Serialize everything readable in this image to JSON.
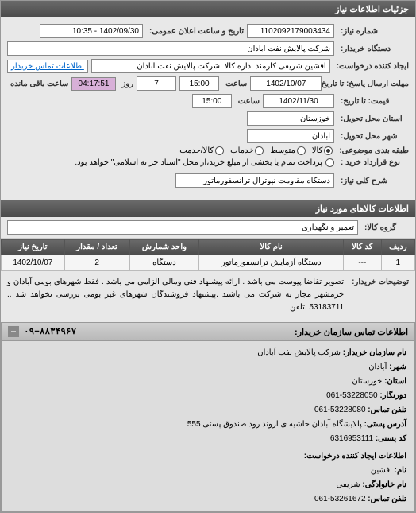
{
  "header": {
    "title": "جزئیات اطلاعات نیاز"
  },
  "form": {
    "request_no_label": "شماره نیاز:",
    "request_no": "1102092179003434",
    "announce_label": "تاریخ و ساعت اعلان عمومی:",
    "announce_value": "1402/09/30 - 10:35",
    "buyer_org_label": "دستگاه خریدار:",
    "buyer_org": "شرکت پالایش نفت آبادان",
    "creator_label": "ایجاد کننده درخواست:",
    "creator": "افشین شریفی کارمند اداره کالا  شرکت پالایش نفت آبادان",
    "contact_link": "اطلاعات تماس خریدار",
    "deadline_label": "مهلت ارسال پاسخ: تا تاریخ:",
    "deadline_date": "1402/10/07",
    "deadline_hour_label": "ساعت",
    "deadline_hour": "15:00",
    "day": "7",
    "day_label": "روز",
    "countdown": "04:17:51",
    "remain_label": "ساعت باقی مانده",
    "price_until_label": "قیمت: تا تاریخ:",
    "price_date": "1402/11/30",
    "price_hour": "15:00",
    "delivery_state_label": "استان محل تحویل:",
    "delivery_state": "خوزستان",
    "delivery_city_label": "شهر محل تحویل:",
    "delivery_city": "آبادان",
    "classification_label": "طبقه بندی موضوعی:",
    "radio_kala": "کالا",
    "radio_khadmat": "خدمات",
    "radio_kala_khadmat": "کالا/خدمت",
    "radio_avg": "متوسط",
    "contract_type_label": "نوع قرارداد خرید :",
    "contract_note": "پرداخت تمام یا بخشی از مبلغ خرید،از محل \"اسناد خزانه اسلامی\" خواهد بود.",
    "need_desc_label": "شرح کلی نیاز:",
    "need_desc": "دستگاه مقاومت نیوترال ترانسفورماتور"
  },
  "goods_section_title": "اطلاعات کالاهای مورد نیاز",
  "goods_group_label": "گروه کالا:",
  "goods_group": "تعمیر و نگهداری",
  "table": {
    "cols": [
      "ردیف",
      "کد کالا",
      "نام کالا",
      "واحد شمارش",
      "تعداد / مقدار",
      "تاریخ نیاز"
    ],
    "rows": [
      {
        "c0": "1",
        "c1": "---",
        "c2": "دستگاه آزمایش ترانسفورماتور",
        "c3": "دستگاه",
        "c4": "2",
        "c5": "1402/10/07"
      }
    ]
  },
  "buyer_notes_label": "توضیحات خریدار:",
  "buyer_notes": "تصویر تقاضا پیوست می باشد . ارائه پیشنهاد فنی ومالی الزامی می باشد . فقط شهرهای بومی آبادان و خرمشهر مجاز به شرکت می باشند .پیشنهاد فروشندگان شهرهای غیر بومی بررسی نخواهد شد .. 53183711 .تلفن",
  "contact": {
    "panel_title": "اطلاعات تماس سازمان خریدار:",
    "barcode": "۰۹−۸۸۳۴۹۶۷",
    "org_label": "نام سازمان خریدار:",
    "org": "شرکت پالایش نفت آبادان",
    "city_label": "شهر:",
    "city": "آبادان",
    "province_label": "استان:",
    "province": "خوزستان",
    "fax_label": "دورنگار:",
    "fax": "53228050-061",
    "phone_label": "تلفن تماس:",
    "phone": "53228080-061",
    "address_label": "آدرس پستی:",
    "address": "پالایشگاه آبادان حاشیه ی اروند رود صندوق پستی 555",
    "postal_label": "کد پستی:",
    "postal": "6316953111",
    "creator_section_label": "اطلاعات ایجاد کننده درخواست:",
    "name_label": "نام:",
    "name": "افشین",
    "family_label": "نام خانوادگی:",
    "family": "شریفی",
    "tel_label": "تلفن تماس:",
    "tel": "53261672-061"
  }
}
